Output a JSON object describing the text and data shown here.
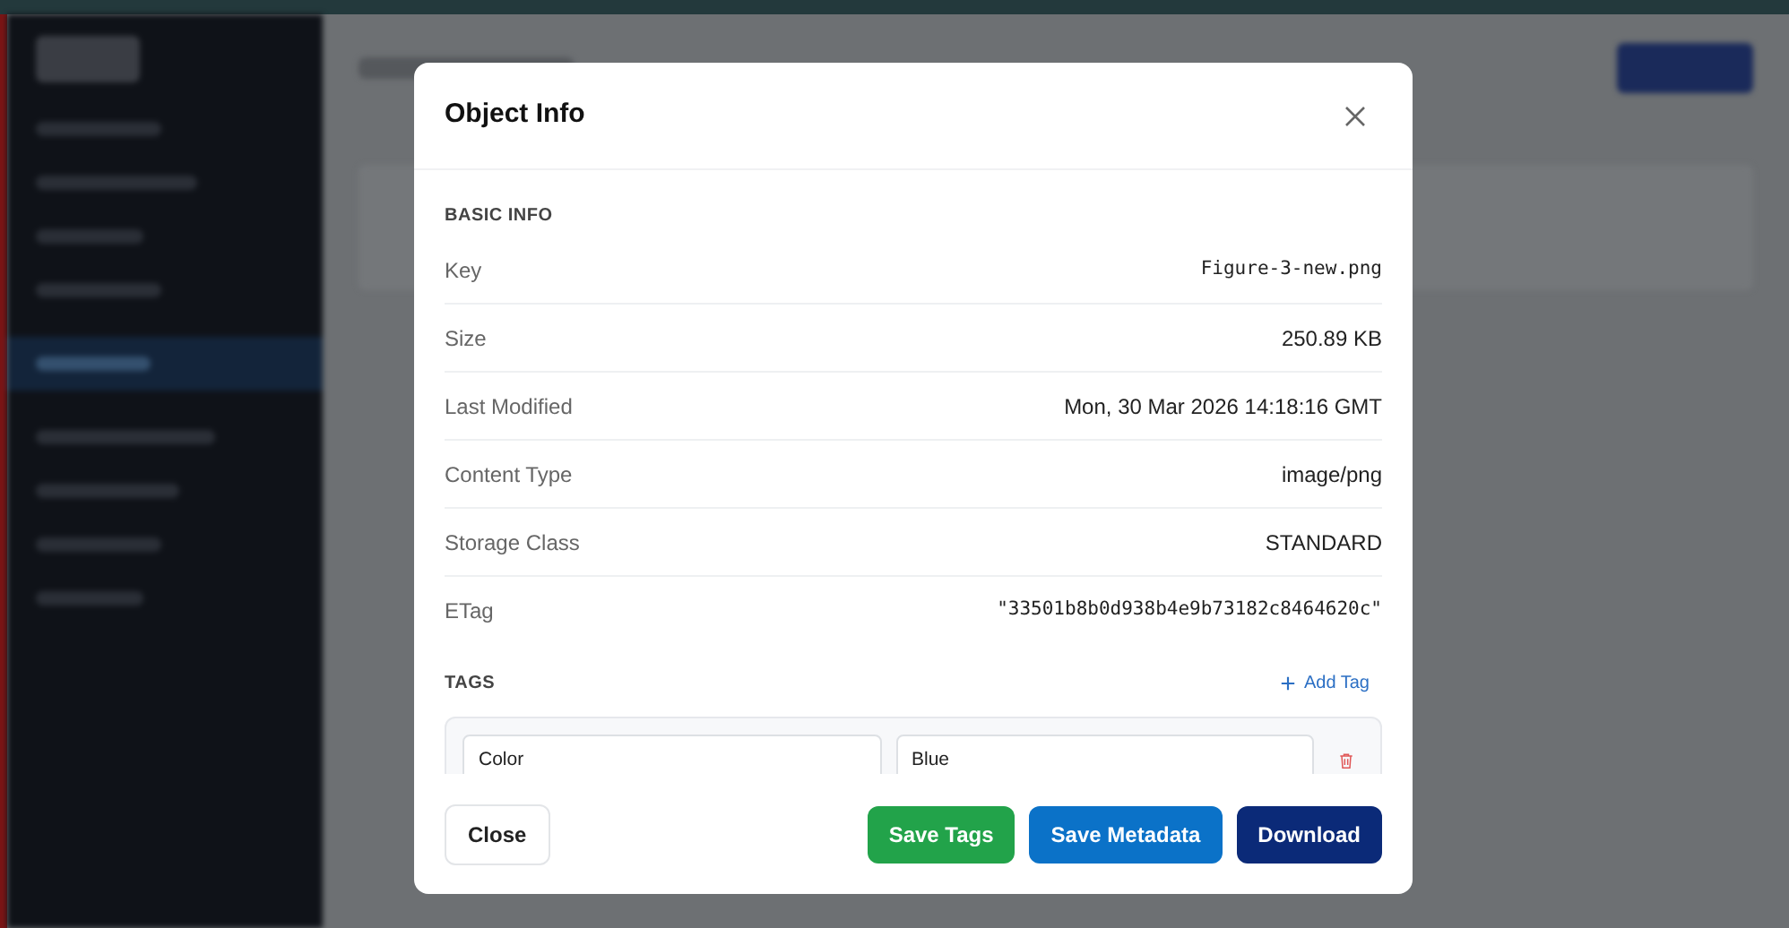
{
  "sidebar": {
    "items": [
      {
        "selected": false
      },
      {
        "selected": false
      },
      {
        "selected": false
      },
      {
        "selected": false
      },
      {
        "selected": true
      },
      {
        "selected": false
      },
      {
        "selected": false
      },
      {
        "selected": false
      },
      {
        "selected": false
      }
    ]
  },
  "dialog": {
    "title": "Object Info",
    "basic_info": {
      "heading": "BASIC INFO",
      "fields": [
        {
          "label": "Key",
          "value": "Figure-3-new.png",
          "kind": "mono"
        },
        {
          "label": "Size",
          "value": "250.89 KB",
          "kind": "text"
        },
        {
          "label": "Last Modified",
          "value": "Mon, 30 Mar 2026 14:18:16 GMT",
          "kind": "text"
        },
        {
          "label": "Content Type",
          "value": "image/png",
          "kind": "text"
        },
        {
          "label": "Storage Class",
          "value": "STANDARD",
          "kind": "text"
        },
        {
          "label": "ETag",
          "value": "\"33501b8b0d938b4e9b73182c8464620c\"",
          "kind": "mono"
        }
      ]
    },
    "tags": {
      "heading": "TAGS",
      "add_label": "Add Tag",
      "items": [
        {
          "key": "Color",
          "value": "Blue"
        }
      ]
    },
    "buttons": [
      {
        "label": "Close",
        "kind": "secondary"
      },
      {
        "label": "Save Tags",
        "kind": "success"
      },
      {
        "label": "Save Metadata",
        "kind": "primary"
      },
      {
        "label": "Download",
        "kind": "dark"
      }
    ]
  }
}
